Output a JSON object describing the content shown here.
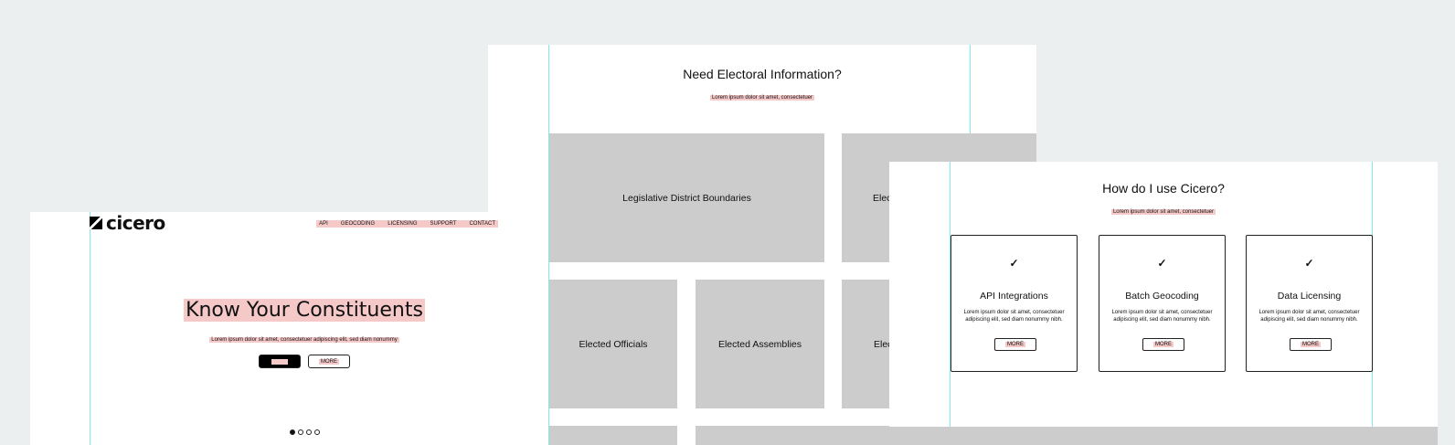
{
  "hero": {
    "logo_text": "cicero",
    "nav": [
      "API",
      "GEOCODING",
      "LICENSING",
      "SUPPORT",
      "CONTACT"
    ],
    "title": "Know Your Constituents",
    "subtitle": "Lorem ipsum dolor sit amet, consectetuer adipiscing elit, sed diam nonummy",
    "primary_button": "",
    "secondary_button": "MORE",
    "slides": 4,
    "active_slide": 1
  },
  "electoral": {
    "title": "Need Electoral Information?",
    "subtitle": "Lorem ipsum dolor sit amet, consectetuer",
    "tiles": [
      "Legislative District Boundaries",
      "Elec",
      "Elected Officials",
      "Elected Assemblies",
      "Elec"
    ]
  },
  "usage": {
    "title": "How do I use Cicero?",
    "subtitle": "Lorem ipsum dolor sit amet, consectetuer",
    "cards": [
      {
        "icon": "✓",
        "title": "API Integrations",
        "text": "Lorem ipsum dolor sit amet, consectetuer adipiscing elit, sed diam nonummy nibh.",
        "button": "MORE"
      },
      {
        "icon": "✓",
        "title": "Batch Geocoding",
        "text": "Lorem ipsum dolor sit amet, consectetuer adipiscing elit, sed diam nonummy nibh.",
        "button": "MORE"
      },
      {
        "icon": "✓",
        "title": "Data Licensing",
        "text": "Lorem ipsum dolor sit amet, consectetuer adipiscing elit, sed diam nonummy nibh.",
        "button": "MORE"
      }
    ]
  },
  "colors": {
    "background": "#ebeff0",
    "highlight": "#f6c9c9",
    "guide": "#7fe9ee",
    "tile": "#cccccc"
  }
}
